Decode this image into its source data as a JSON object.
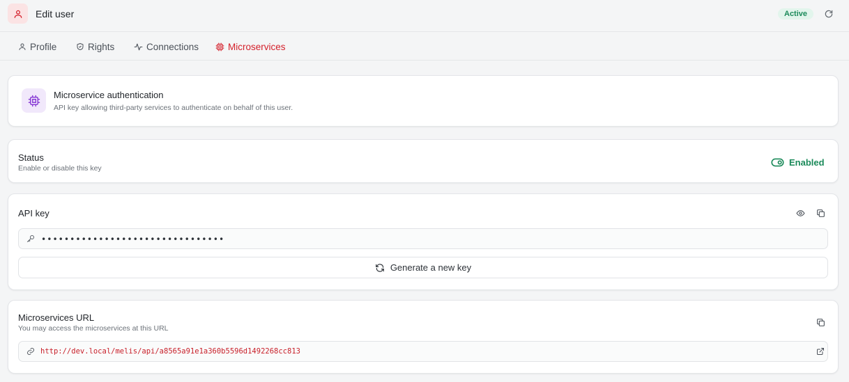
{
  "header": {
    "title": "Edit user",
    "status_badge": "Active",
    "accent_color": "#d4202b"
  },
  "tabs": [
    {
      "label": "Profile",
      "icon": "user-icon"
    },
    {
      "label": "Rights",
      "icon": "shield-icon"
    },
    {
      "label": "Connections",
      "icon": "activity-icon"
    },
    {
      "label": "Microservices",
      "icon": "chip-icon",
      "active": true
    }
  ],
  "auth_card": {
    "title": "Microservice authentication",
    "subtitle": "API key allowing third-party services to authenticate on behalf of this user.",
    "icon": "chip-icon"
  },
  "status_card": {
    "title": "Status",
    "subtitle": "Enable or disable this key",
    "toggle_label": "Enabled",
    "toggle_on": true
  },
  "api_key_card": {
    "title": "API key",
    "masked_value": "••••••••••••••••••••••••••••••••",
    "generate_label": "Generate a new key"
  },
  "url_card": {
    "title": "Microservices URL",
    "subtitle": "You may access the microservices at this URL",
    "url": "http://dev.local/melis/api/a8565a91e1a360b5596d1492268cc813"
  }
}
